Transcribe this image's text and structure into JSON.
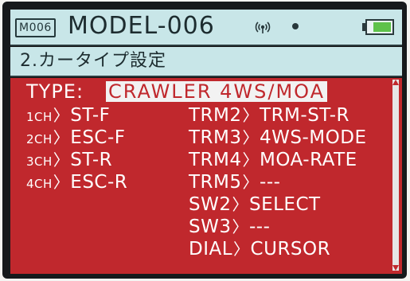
{
  "header": {
    "model_id": "M006",
    "model_name": "MODEL-006",
    "battery_level": 0.8,
    "battery_color": "#5ec24a",
    "signal_icon": "wireless-signal-icon",
    "status_icon": "status-dot-icon"
  },
  "menu": {
    "title": "2.カータイプ設定"
  },
  "panel": {
    "background": "#c0282d",
    "type_label": "TYPE:",
    "type_value": "CRAWLER 4WS/MOA",
    "channels": [
      {
        "prefix": "1CH",
        "value": "ST-F"
      },
      {
        "prefix": "2CH",
        "value": "ESC-F"
      },
      {
        "prefix": "3CH",
        "value": "ST-R"
      },
      {
        "prefix": "4CH",
        "value": "ESC-R"
      }
    ],
    "assignments": [
      {
        "key": "TRM2",
        "value": "TRM-ST-R"
      },
      {
        "key": "TRM3",
        "value": "4WS-MODE"
      },
      {
        "key": "TRM4",
        "value": "MOA-RATE"
      },
      {
        "key": "TRM5",
        "value": "---"
      },
      {
        "key": "SW2",
        "value": "SELECT"
      },
      {
        "key": "SW3",
        "value": "---"
      },
      {
        "key": "DIAL",
        "value": "CURSOR"
      }
    ]
  }
}
